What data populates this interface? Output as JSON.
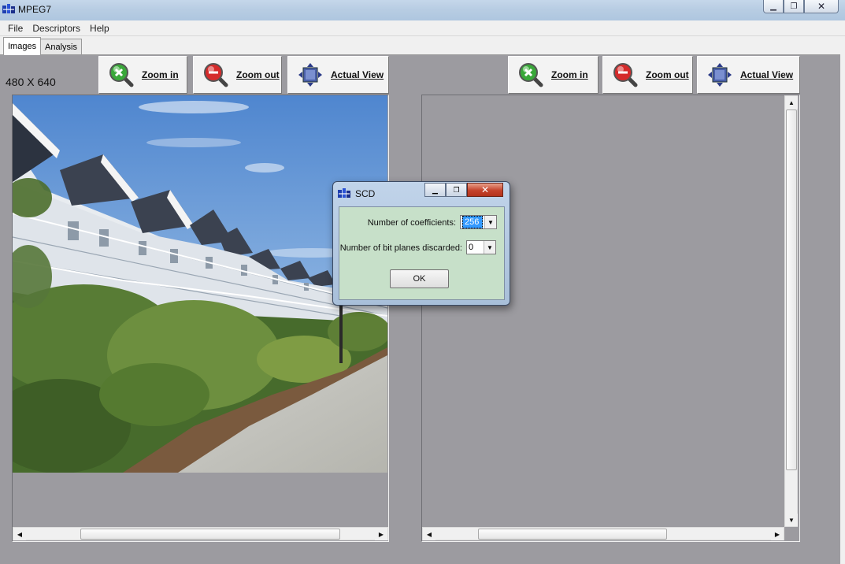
{
  "window": {
    "title": "MPEG7"
  },
  "menu": [
    "File",
    "Descriptors",
    "Help"
  ],
  "tabs": [
    {
      "label": "Images",
      "active": true
    },
    {
      "label": "Analysis",
      "active": false
    }
  ],
  "left_panel": {
    "dimensions": "480 X 640",
    "zoom_in_label": "Zoom in",
    "zoom_out_label": "Zoom out",
    "actual_view_label": "Actual View"
  },
  "right_panel": {
    "zoom_in_label": "Zoom in",
    "zoom_out_label": "Zoom out",
    "actual_view_label": "Actual View"
  },
  "dialog": {
    "title": "SCD",
    "coefficients_label": "Number of coefficients:",
    "coefficients_value": "256",
    "bitplanes_label": "Number of bit planes discarded:",
    "bitplanes_value": "0",
    "ok_label": "OK"
  },
  "colors": {
    "workspace": "#9c9ba0",
    "dialog_body": "#c7e0c9",
    "close_button": "#c4422b"
  }
}
